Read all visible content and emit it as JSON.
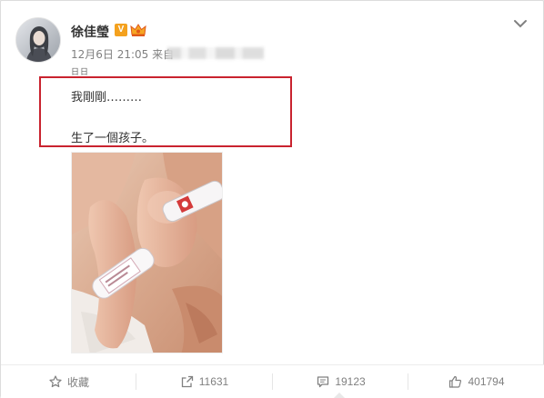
{
  "user": {
    "name": "徐佳瑩",
    "verified_badge": "V",
    "avatar_icon": "avatar-woman-portrait"
  },
  "post": {
    "date_time": "12月6日 21:05",
    "source_prefix": "来自",
    "small_text": "日日",
    "line1": "我剛剛………",
    "line2": "生了一個孩子。"
  },
  "actions": {
    "favorite_label": "收藏",
    "repost_count": "11631",
    "comment_count": "19123",
    "like_count": "401794"
  },
  "colors": {
    "highlight": "#c9232f",
    "verified": "#f4a11e",
    "text_muted": "#808080"
  }
}
